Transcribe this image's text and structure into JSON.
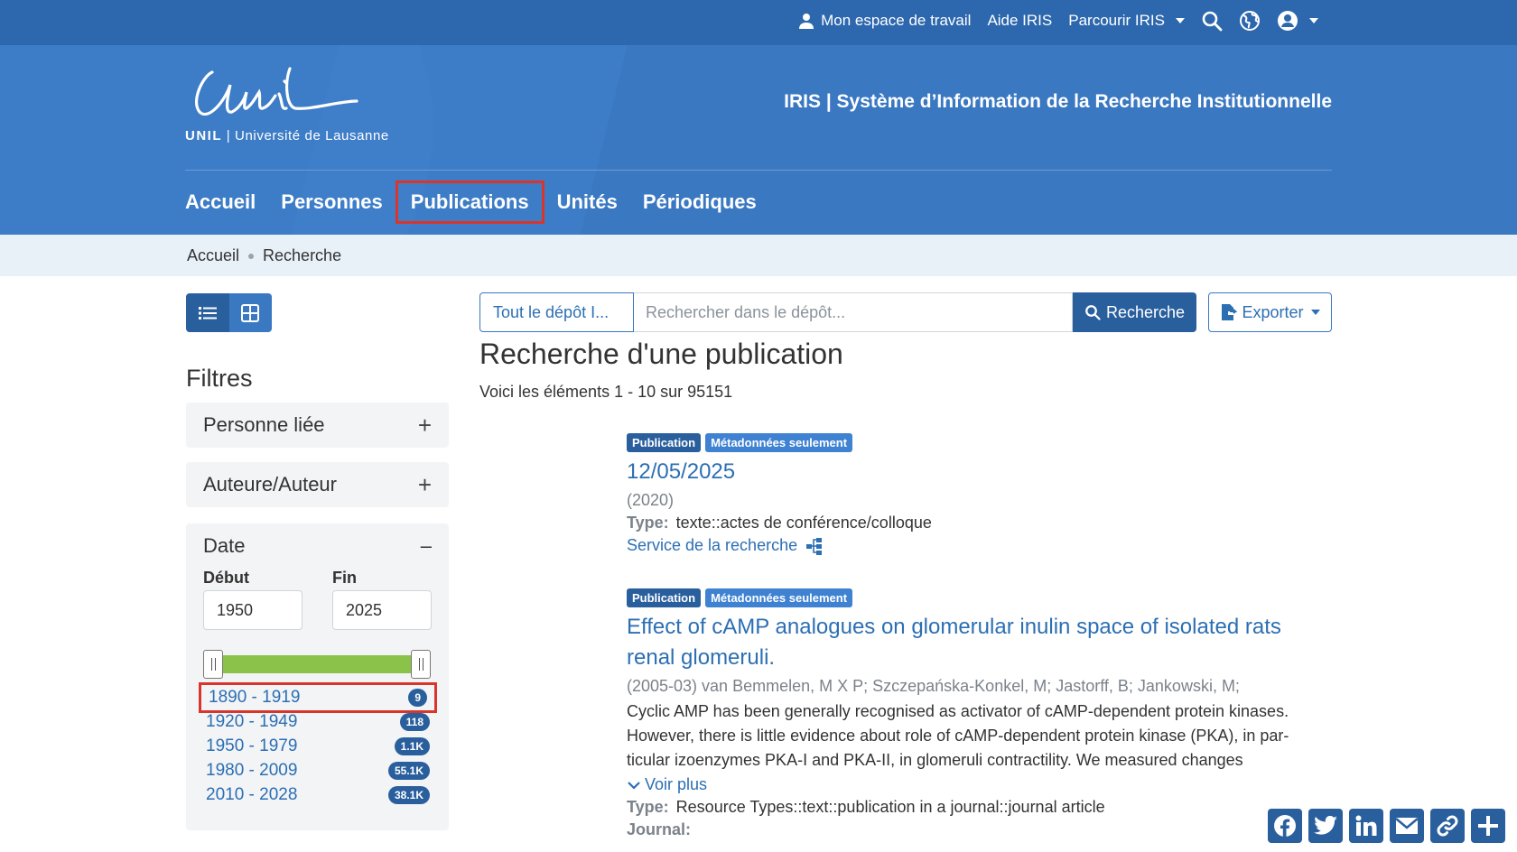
{
  "topnav": {
    "workspace": "Mon espace de travail",
    "help": "Aide IRIS",
    "browse": "Parcourir IRIS"
  },
  "logo": {
    "short": "UNIL",
    "full": "Université de Lausanne"
  },
  "site_title": "IRIS | Système d’Information de la Recherche Institutionnelle",
  "mainnav": [
    "Accueil",
    "Personnes",
    "Publications",
    "Unités",
    "Périodiques"
  ],
  "breadcrumb": [
    "Accueil",
    "Recherche"
  ],
  "filters": {
    "title": "Filtres",
    "facets": [
      "Personne liée",
      "Auteure/Auteur"
    ],
    "date": {
      "label": "Date",
      "start_label": "Début",
      "end_label": "Fin",
      "start_value": "1950",
      "end_value": "2025",
      "ranges": [
        {
          "label": "1890 - 1919",
          "count": "9"
        },
        {
          "label": "1920 - 1949",
          "count": "118"
        },
        {
          "label": "1950 - 1979",
          "count": "1.1K"
        },
        {
          "label": "1980 - 2009",
          "count": "55.1K"
        },
        {
          "label": "2010 - 2028",
          "count": "38.1K"
        }
      ]
    }
  },
  "search": {
    "scope": "Tout le dépôt I...",
    "placeholder": "Rechercher dans le dépôt...",
    "button": "Recherche",
    "export": "Exporter"
  },
  "page_title": "Recherche d'une publication",
  "results_count": "Voici les éléments 1 - 10 sur 95151",
  "results": [
    {
      "tag1": "Publication",
      "tag2": "Métadonnées seulement",
      "title": "12/05/2025",
      "date": "(2020)",
      "type_label": "Type:",
      "type": "texte::actes de conférence/colloque",
      "link": "Service de la recherche"
    },
    {
      "tag1": "Publication",
      "tag2": "Métadonnées seulement",
      "title": "Effect of cAMP analogues on glomerular inulin space of isolated rats renal glomeruli.",
      "date": "(2005-03) van Bemmelen, M X P; Szczepańska-Konkel, M; Jastorff, B; Jankowski, M;",
      "abstract": "Cyclic AMP has been generally recognised as activator of cAMP-dependent protein kinases. However, there is little evidence about role of cAMP-dependent protein kinase (PKA), in par­ticular izoenzymes PKA-I and PKA-II, in glomeruli contractility. We measured changes",
      "more": "Voir plus",
      "type_label": "Type:",
      "type": "Resource Types::text::publication in a journal::journal article",
      "journal_label": "Journal:"
    }
  ],
  "share": [
    "Facebook",
    "Twitter",
    "LinkedIn",
    "Email",
    "Copy Link",
    "Share"
  ]
}
